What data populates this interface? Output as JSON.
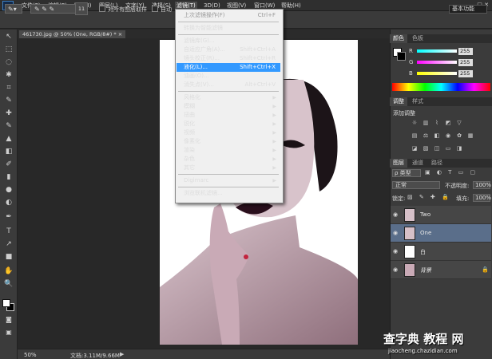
{
  "app": {
    "logo": "Ps",
    "workspace": "基本功能",
    "window_controls": "—  □  ✕"
  },
  "menubar": {
    "items": [
      "文件(F)",
      "编辑(E)",
      "图像(I)",
      "图层(L)",
      "文字(Y)",
      "选择(S)",
      "滤镜(T)",
      "3D(D)",
      "视图(V)",
      "窗口(W)",
      "帮助(H)"
    ],
    "active_index": 6
  },
  "options_bar": {
    "size": "11",
    "sample_all_layers": "对所有图层取样",
    "auto_enhance": "自动"
  },
  "document": {
    "tab_title": "461730.jpg @ 50% (One, RGB/8#) * ×"
  },
  "status_bar": {
    "zoom": "50%",
    "doc_size": "文档:3.11M/9.66M"
  },
  "tools": [
    "↖",
    "⬚",
    "◌",
    "✱",
    "⌗",
    "✎",
    "✚",
    "✎",
    "▲",
    "◧",
    "✐",
    "▮",
    "●",
    "◐",
    "✒",
    "T",
    "↗",
    "■",
    "✋",
    "🔍"
  ],
  "filter_menu": {
    "items": [
      {
        "label": "上次滤镜操作(F)",
        "shortcut": "Ctrl+F",
        "disabled": true
      },
      {
        "sep": true
      },
      {
        "label": "转换为智能滤镜"
      },
      {
        "sep": true
      },
      {
        "label": "滤镜库(G)..."
      },
      {
        "label": "自适应广角(A)...",
        "shortcut": "Shift+Ctrl+A"
      },
      {
        "label": "镜头校正(R)...",
        "shortcut": "Shift+Ctrl+R"
      },
      {
        "label": "液化(L)...",
        "shortcut": "Shift+Ctrl+X",
        "highlight": true
      },
      {
        "label": "油画(O)..."
      },
      {
        "label": "消失点(V)...",
        "shortcut": "Alt+Ctrl+V"
      },
      {
        "sep": true
      },
      {
        "label": "风格化",
        "submenu": true
      },
      {
        "label": "模糊",
        "submenu": true
      },
      {
        "label": "扭曲",
        "submenu": true
      },
      {
        "label": "锐化",
        "submenu": true
      },
      {
        "label": "视频",
        "submenu": true
      },
      {
        "label": "像素化",
        "submenu": true
      },
      {
        "label": "渲染",
        "submenu": true
      },
      {
        "label": "杂色",
        "submenu": true
      },
      {
        "label": "其它",
        "submenu": true
      },
      {
        "sep": true
      },
      {
        "label": "Digimarc",
        "submenu": true
      },
      {
        "sep": true
      },
      {
        "label": "浏览联机滤镜..."
      }
    ]
  },
  "color_panel": {
    "tabs": [
      "颜色",
      "色板"
    ],
    "channels": [
      {
        "label": "R",
        "value": "255"
      },
      {
        "label": "G",
        "value": "255"
      },
      {
        "label": "B",
        "value": "255"
      }
    ]
  },
  "adjust_panel": {
    "tabs": [
      "调整",
      "样式"
    ],
    "title": "添加调整"
  },
  "layers_panel": {
    "tabs": [
      "图层",
      "通道",
      "路径"
    ],
    "filter_label": "ρ 类型",
    "blend_mode": "正常",
    "opacity_label": "不透明度:",
    "opacity": "100%",
    "lock_label": "锁定:",
    "fill_label": "填充:",
    "fill": "100%",
    "layers": [
      {
        "name": "Two",
        "selected": false
      },
      {
        "name": "One",
        "selected": true
      },
      {
        "name": "白",
        "selected": false
      },
      {
        "name": "背景",
        "selected": false
      }
    ]
  },
  "watermark": {
    "text": "查字典 教程 网",
    "url": "jiaocheng.chazidian.com"
  }
}
